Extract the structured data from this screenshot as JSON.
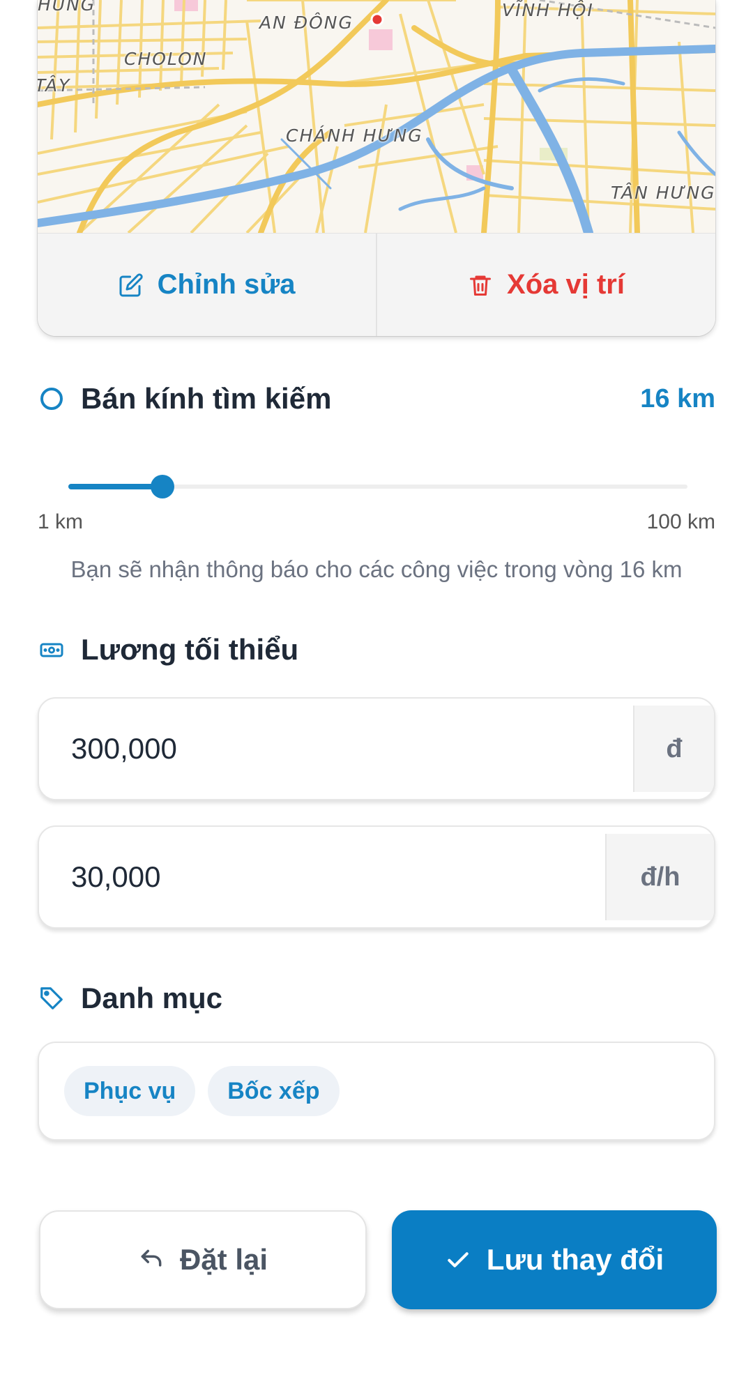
{
  "map": {
    "labels": [
      "HUNG",
      "AN ĐÔNG",
      "VĨNH HỘI",
      "CHOLON",
      "TÂY",
      "CHÁNH HƯNG",
      "TÂN HƯNG"
    ],
    "edit_label": "Chỉnh sửa",
    "delete_label": "Xóa vị trí"
  },
  "radius": {
    "title": "Bán kính tìm kiếm",
    "value_label": "16 km",
    "value_km": 16,
    "min_km": 1,
    "max_km": 100,
    "min_label": "1 km",
    "max_label": "100 km",
    "note": "Bạn sẽ nhận thông báo cho các công việc trong vòng 16 km"
  },
  "salary": {
    "title": "Lương tối thiểu",
    "daily_value": "300,000",
    "daily_unit": "đ",
    "hourly_value": "30,000",
    "hourly_unit": "đ/h"
  },
  "categories": {
    "title": "Danh mục",
    "items": [
      "Phục vụ",
      "Bốc xếp"
    ]
  },
  "actions": {
    "reset_label": "Đặt lại",
    "save_label": "Lưu thay đổi"
  },
  "colors": {
    "accent": "#1684c4",
    "danger": "#e53935",
    "map_road": "#f5d77f",
    "map_water": "#7fb2e5"
  },
  "icons": {
    "edit": "pencil-square-icon",
    "delete": "trash-icon",
    "radius": "circle-icon",
    "salary": "banknote-icon",
    "category": "tag-icon",
    "reset": "undo-icon",
    "save": "check-icon"
  }
}
